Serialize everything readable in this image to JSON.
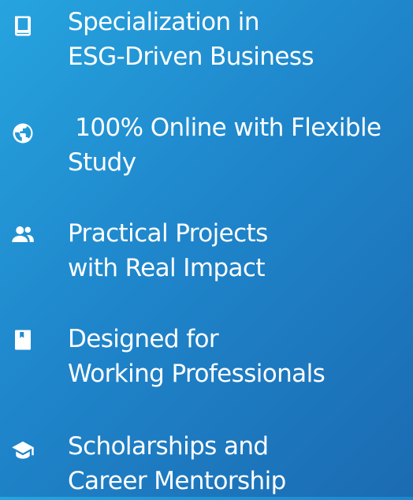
{
  "features": [
    {
      "icon": "book-icon",
      "line1": "Specialization in",
      "line2": "ESG-Driven Business"
    },
    {
      "icon": "globe-icon",
      "line1": " 100% Online with Flexible",
      "line2": "Study"
    },
    {
      "icon": "users-icon",
      "line1": "Practical Projects",
      "line2": "with Real Impact"
    },
    {
      "icon": "bookmark-icon",
      "line1": "Designed for",
      "line2": "Working Professionals"
    },
    {
      "icon": "graduation-cap-icon",
      "line1": "Scholarships and",
      "line2": "Career Mentorship"
    }
  ],
  "colors": {
    "gradient_start": "#26a4df",
    "gradient_end": "#1b6bb2",
    "text": "#ffffff"
  }
}
